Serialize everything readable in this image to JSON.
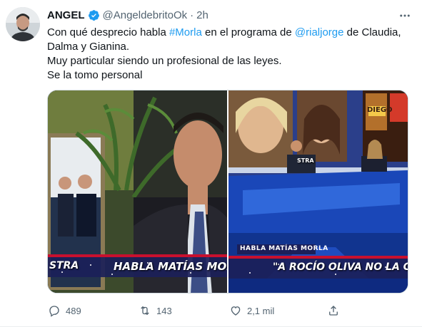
{
  "author": {
    "display_name": "ANGEL",
    "handle": "@AngeldebritoOk",
    "separator": "·",
    "time": "2h"
  },
  "tweet": {
    "line1_pre": "Con qué desprecio habla ",
    "hashtag": "#Morla",
    "line1_mid": " en el programa de ",
    "mention": "@rialjorge",
    "line1_post": " de Claudia,",
    "line2": "Dalma y Gianina.",
    "line3": "Muy particular siendo un profesional de las leyes.",
    "line4": "Se la tomo personal"
  },
  "media": {
    "left_chyron_prefix": "STRA",
    "left_chyron": "HABLA MATÍAS MORRA",
    "right_label": "HABLA MATÍAS MORLA",
    "right_chyron": "\"A ROCÍO OLIVA NO LA C",
    "right_tag": "DIEGO",
    "desk_text": "STRA"
  },
  "actions": {
    "reply_count": "489",
    "retweet_count": "143",
    "like_count": "2,1 mil"
  },
  "colors": {
    "accent": "#1d9bf0",
    "muted": "#536471",
    "chyron_red": "#c8102e"
  },
  "icons": {
    "verified": "verified-badge-icon",
    "more": "more-horizontal-icon",
    "reply": "reply-icon",
    "retweet": "retweet-icon",
    "like": "heart-icon",
    "share": "share-icon"
  }
}
